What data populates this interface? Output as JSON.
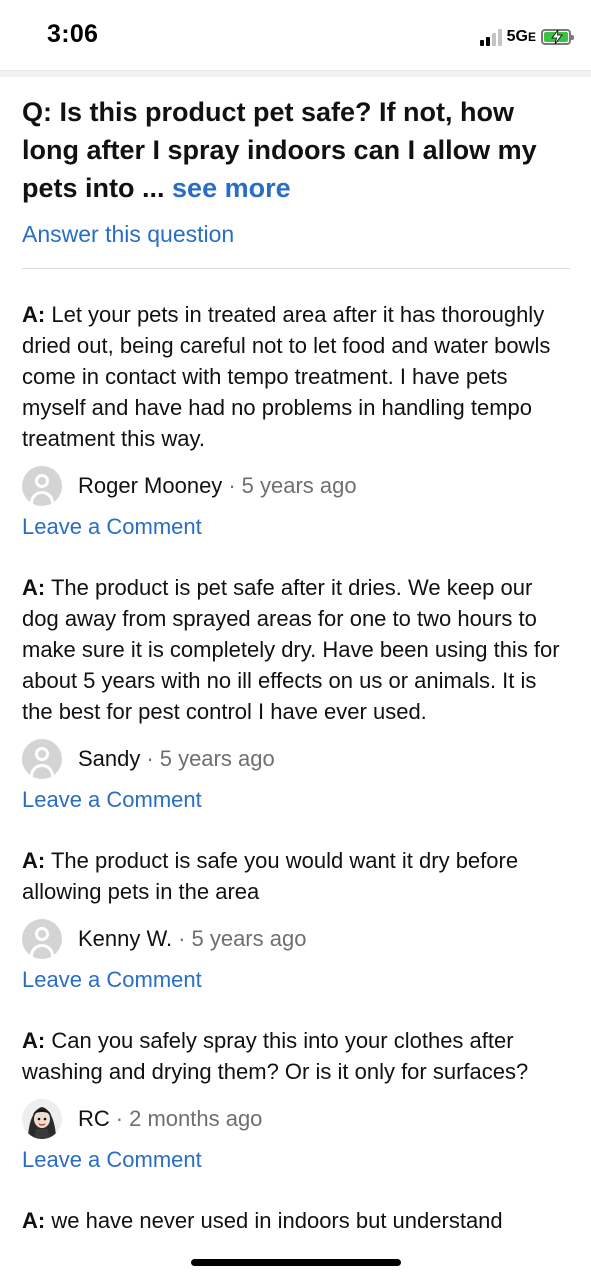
{
  "status": {
    "time": "3:06",
    "network": "5G",
    "network_suffix": "E"
  },
  "question": {
    "prefix": "Q: ",
    "text": "Is this product pet safe? If not, how long after I spray indoors can I allow my pets into ...",
    "see_more": "see more",
    "answer_link": "Answer this question"
  },
  "answers": [
    {
      "prefix": "A:",
      "text": "Let your pets in treated area after it has thoroughly dried out, being careful not to let food and water bowls come in contact with tempo treatment. I have pets myself and have had no problems in handling tempo treatment this way.",
      "author": "Roger Mooney",
      "separator": "·",
      "time": "5 years ago",
      "comment_label": "Leave a Comment"
    },
    {
      "prefix": "A:",
      "text": "The product is pet safe after it dries. We keep our dog away from sprayed areas for one to two hours to make sure it is completely dry. Have been using this for about 5 years with no ill effects on us or animals. It is the best for pest control I have ever used.",
      "author": "Sandy",
      "separator": "·",
      "time": "5 years ago",
      "comment_label": "Leave a Comment"
    },
    {
      "prefix": "A:",
      "text": "The product is safe you would want it dry before allowing pets in the area",
      "author": "Kenny W.",
      "separator": "·",
      "time": "5 years ago",
      "comment_label": "Leave a Comment"
    },
    {
      "prefix": "A:",
      "text": "Can you safely spray this into your clothes after washing and drying them? Or is it only for surfaces?",
      "author": "RC",
      "separator": "·",
      "time": "2 months ago",
      "comment_label": "Leave a Comment"
    },
    {
      "prefix": "A:",
      "text": "we have never used in indoors but understand",
      "author": "",
      "separator": "",
      "time": "",
      "comment_label": ""
    }
  ],
  "colors": {
    "link": "#2a6dc5",
    "text": "#111111",
    "muted": "#6f6f6f"
  },
  "icons": {
    "default_avatar": "user-silhouette-icon",
    "rc_avatar": "cartoon-avatar-icon"
  }
}
